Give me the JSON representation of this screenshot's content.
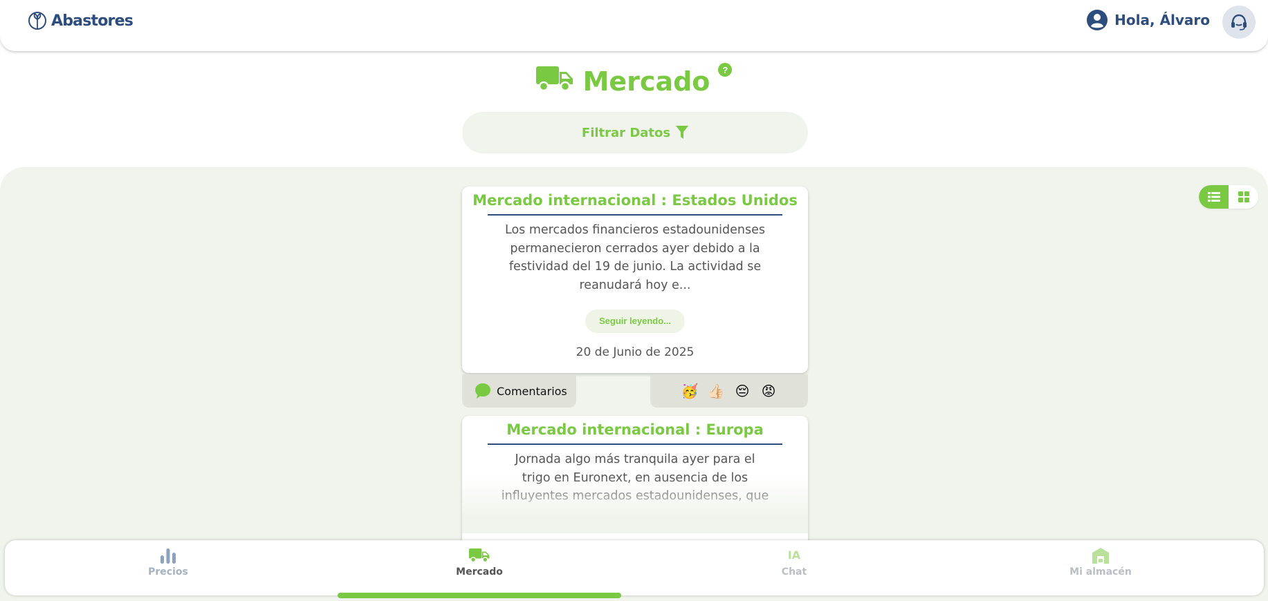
{
  "header": {
    "brand": "Abastores",
    "greeting": "Hola, Álvaro",
    "user_icon": "user-circle-icon",
    "support_icon": "headset-icon"
  },
  "page": {
    "title": "Mercado",
    "title_icon": "truck-icon",
    "help_glyph": "?",
    "filter_label": "Filtrar Datos",
    "filter_icon": "funnel-icon"
  },
  "view_toggle": {
    "active": "list",
    "options": [
      "list",
      "grid"
    ]
  },
  "cards": [
    {
      "title": "Mercado internacional : Estados Unidos",
      "body": "Los mercados financieros estadounidenses permanecieron cerrados ayer debido a la festividad del 19 de junio. La actividad se reanudará hoy e...",
      "read_more": "Seguir leyendo...",
      "date": "20 de Junio de 2025",
      "comments_label": "Comentarios",
      "reactions": [
        "🥳",
        "👍🏻",
        "😔",
        "😡"
      ]
    },
    {
      "title": "Mercado internacional : Europa",
      "body": "Jornada algo más tranquila ayer para el trigo en Euronext, en ausencia de los influyentes mercados estadounidenses, que"
    }
  ],
  "nav": {
    "items": [
      {
        "label": "Precios",
        "icon": "bar-chart-icon"
      },
      {
        "label": "Mercado",
        "icon": "truck-icon"
      },
      {
        "label": "Chat",
        "icon": "ia-icon",
        "icon_text": "IA"
      },
      {
        "label": "Mi almacén",
        "icon": "warehouse-icon"
      }
    ],
    "active": "Mercado"
  },
  "colors": {
    "brand_green": "#7ac943",
    "brand_blue": "#2e4d7f",
    "content_bg": "#f1f4ec"
  }
}
